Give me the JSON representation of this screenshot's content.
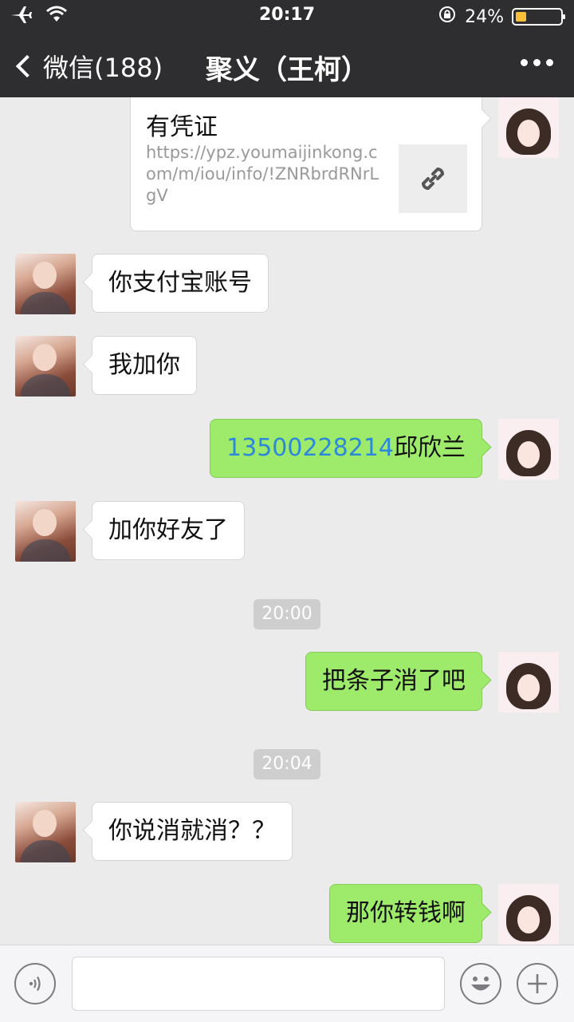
{
  "status_bar": {
    "time": "20:17",
    "battery": "24%",
    "battery_level": 0.24
  },
  "nav": {
    "back_label": "微信(188)",
    "title": "聚义（王柯）"
  },
  "link_card": {
    "title": "有凭证",
    "url": "https://ypz.youmaijinkong.com/m/iou/info/!ZNRbrdRNrLgV"
  },
  "messages": [
    {
      "side": "left",
      "text": "你支付宝账号"
    },
    {
      "side": "left",
      "text": "我加你"
    },
    {
      "side": "right",
      "phone": "13500228214",
      "text": "邱欣兰"
    },
    {
      "side": "left",
      "text": "加你好友了"
    },
    {
      "side": "right",
      "text": "把条子消了吧"
    },
    {
      "side": "left",
      "text": "你说消就消？？"
    },
    {
      "side": "right",
      "text": "那你转钱啊"
    }
  ],
  "timestamps": [
    "20:00",
    "20:04"
  ],
  "input": {
    "value": "",
    "placeholder": ""
  },
  "colors": {
    "nav_bg": "#2e2e30",
    "chat_bg": "#ebebeb",
    "bubble_mine": "#9eea6a",
    "bubble_theirs": "#ffffff",
    "phone_link": "#2c88d9",
    "battery_fill": "#f8c03a"
  }
}
